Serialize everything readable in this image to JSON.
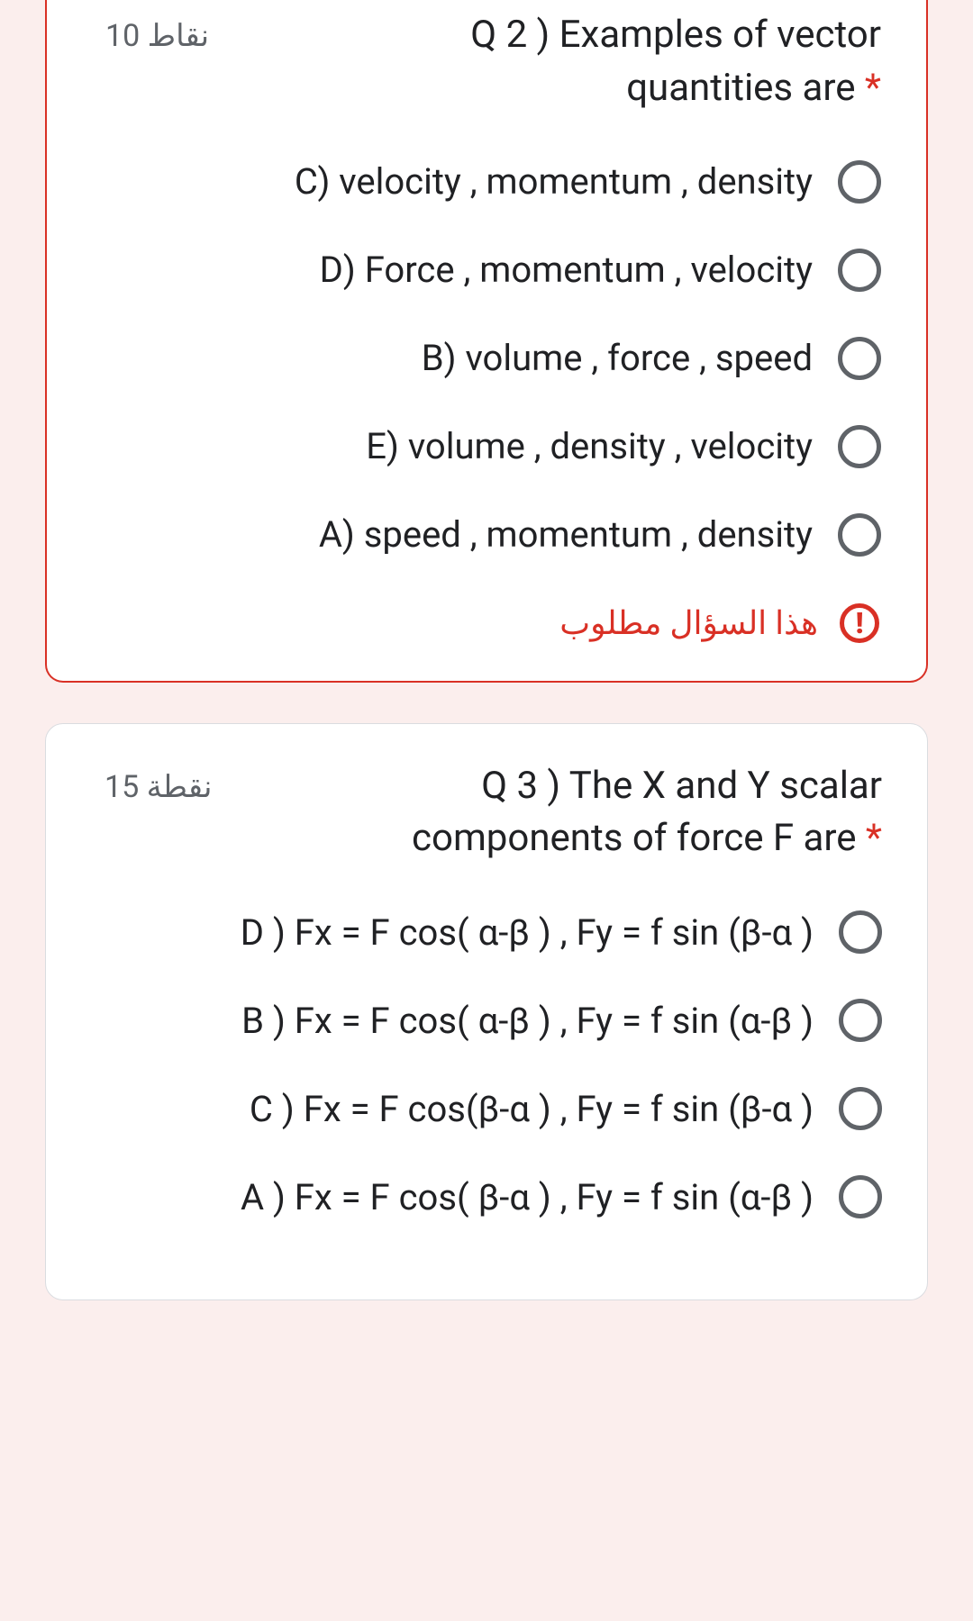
{
  "question2": {
    "points": "10 نقاط",
    "title_line1": "Q 2 ) Examples of vector",
    "title_line2": "quantities are",
    "asterisk": "*",
    "options": [
      "C) velocity , momentum , density",
      "D) Force , momentum , velocity",
      "B) volume , force , speed",
      "E) volume , density , velocity",
      "A) speed , momentum , density"
    ],
    "required_text": "هذا السؤال مطلوب",
    "error_icon_glyph": "!"
  },
  "question3": {
    "points": "15 نقطة",
    "title_line1": "Q 3 ) The X and Y scalar",
    "title_line2": "components of force F are",
    "asterisk": "*",
    "options": [
      "D ) Fx = F cos( α-β ) , Fy = f sin (β-α )",
      "B ) Fx = F cos( α-β ) , Fy = f sin (α-β )",
      "C ) Fx = F cos(β-α ) , Fy = f sin (β-α )",
      "A ) Fx = F cos( β-α ) , Fy = f sin (α-β )"
    ]
  }
}
